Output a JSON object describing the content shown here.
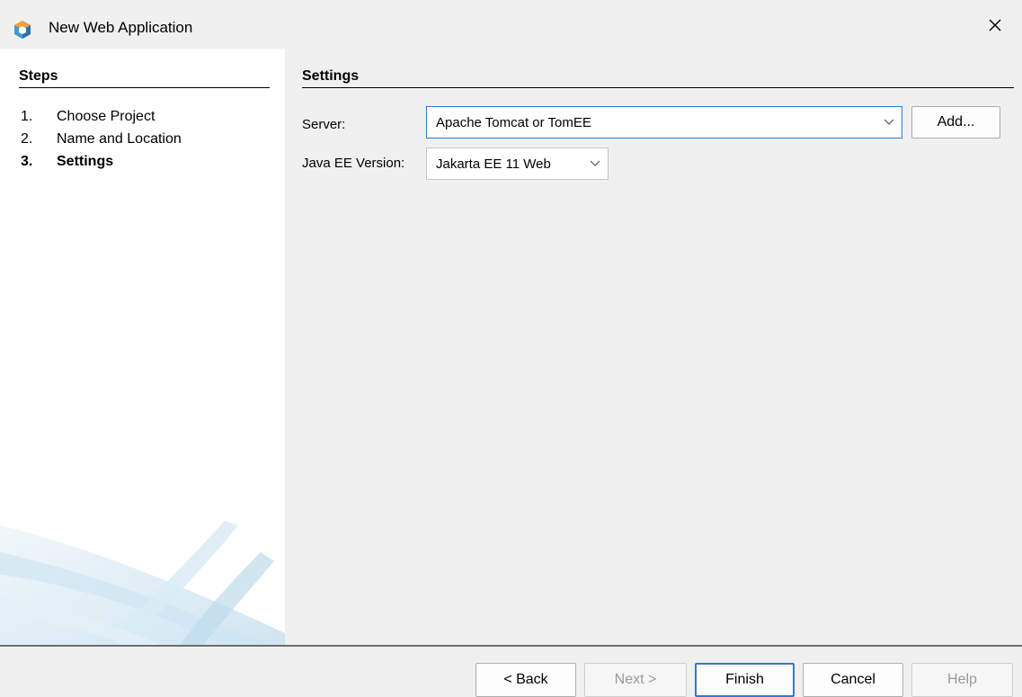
{
  "window": {
    "title": "New Web Application",
    "icon": "netbeans-cube-icon",
    "close_glyph": "✕"
  },
  "steps": {
    "heading": "Steps",
    "items": [
      {
        "num": "1.",
        "label": "Choose Project",
        "current": false
      },
      {
        "num": "2.",
        "label": "Name and Location",
        "current": false
      },
      {
        "num": "3.",
        "label": "Settings",
        "current": true
      }
    ]
  },
  "settings": {
    "heading": "Settings",
    "server": {
      "label": "Server:",
      "value": "Apache Tomcat or TomEE"
    },
    "add_button": "Add...",
    "java_ee": {
      "label": "Java EE Version:",
      "value": "Jakarta EE 11 Web"
    }
  },
  "buttons": {
    "back": "< Back",
    "next": "Next >",
    "finish": "Finish",
    "cancel": "Cancel",
    "help": "Help"
  },
  "colors": {
    "accent": "#2d7ad6",
    "background": "#f0f0f0",
    "panel": "#ffffff",
    "disabled_text": "#9a9a9a"
  }
}
